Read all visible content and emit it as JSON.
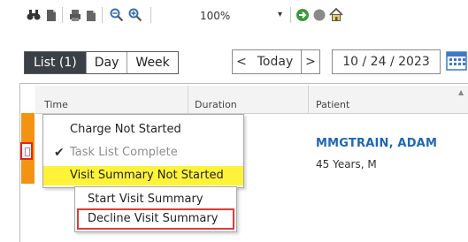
{
  "toolbar": {
    "icons": [
      "binoculars-icon",
      "document-icon",
      "print-icon",
      "document-stack-icon",
      "zoom-out-icon",
      "zoom-in-icon",
      "go-arrow-icon",
      "stop-icon",
      "home-icon"
    ],
    "zoom_value": "100%",
    "zoom_arrow": "▾"
  },
  "view_tabs": {
    "list": "List (1)",
    "day": "Day",
    "week": "Week"
  },
  "date_nav": {
    "prev": "<",
    "today": "Today",
    "next": ">",
    "date": "10 / 24 / 2023"
  },
  "grid": {
    "columns": [
      "Time",
      "Duration",
      "Patient"
    ],
    "sort_indicator": "▲"
  },
  "patient": {
    "name": "MMGTRAIN, ADAM",
    "info": "45 Years, M"
  },
  "context_menu": {
    "items": [
      {
        "label": "Charge Not Started",
        "state": "normal"
      },
      {
        "label": "Task List Complete",
        "state": "disabled-checked"
      },
      {
        "label": "Visit Summary Not Started",
        "state": "highlighted"
      }
    ],
    "check_glyph": "✔"
  },
  "submenu": {
    "items": [
      "Start Visit Summary",
      "Decline Visit Summary"
    ]
  },
  "colors": {
    "status_bar": "#f39312",
    "highlight": "#fff33a",
    "annotation_red": "#e02424",
    "patient_link": "#1f67b4",
    "active_tab": "#3b3f46"
  }
}
